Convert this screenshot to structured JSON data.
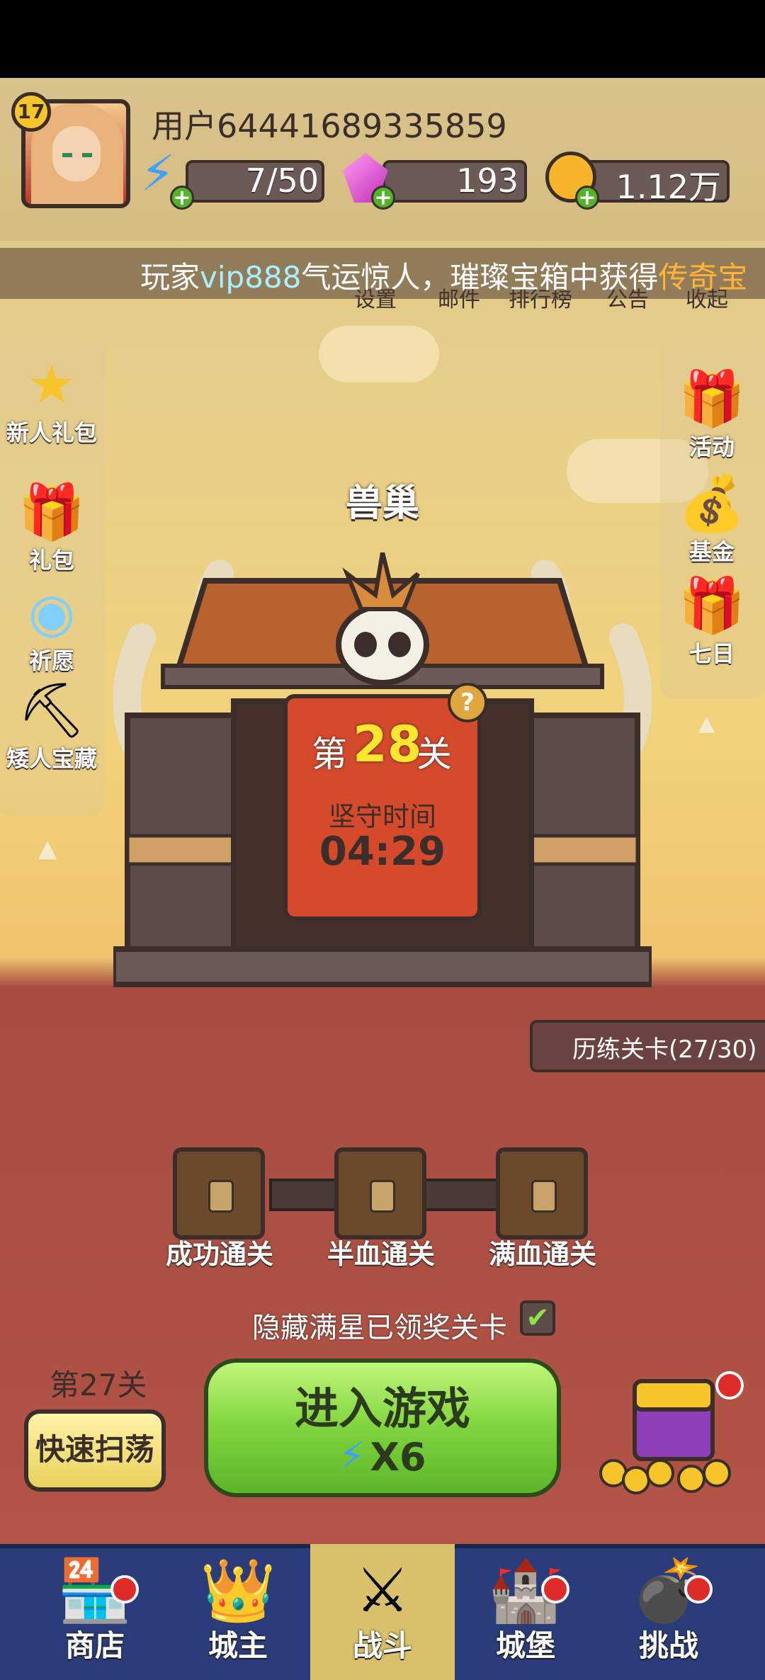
{
  "player": {
    "level": "17",
    "username": "用户64441689335859",
    "energy": "7/50",
    "gems": "193",
    "gold": "1.12万"
  },
  "ticker": {
    "prefix": "玩家",
    "vip": "vip888",
    "middle": "气运惊人，璀璨宝箱中获得",
    "legend": "传奇宝"
  },
  "top_nav": [
    "设置",
    "邮件",
    "排行榜",
    "公告",
    "收起"
  ],
  "left_menu": [
    {
      "label": "新人礼包",
      "icon": "star-1-icon"
    },
    {
      "label": "礼包",
      "icon": "gift-icon"
    },
    {
      "label": "祈愿",
      "icon": "wish-orb-icon"
    },
    {
      "label": "矮人宝藏",
      "icon": "pickaxe-icon"
    }
  ],
  "right_menu": [
    {
      "label": "活动",
      "icon": "activity-gift-icon"
    },
    {
      "label": "基金",
      "icon": "fund-bag-icon"
    },
    {
      "label": "七日",
      "icon": "seven-day-gift-icon"
    }
  ],
  "level": {
    "name": "兽巢",
    "stage_prefix": "第",
    "stage_number": "28",
    "stage_suffix": "关",
    "hold_label": "坚守时间",
    "hold_time": "04:29",
    "help": "?"
  },
  "trial": "历练关卡(27/30)",
  "chests": [
    "成功通关",
    "半血通关",
    "满血通关"
  ],
  "hidden_claim_label": "隐藏满星已领奖关卡",
  "hidden_claim_checked": true,
  "sweep": {
    "stage": "第27关",
    "button": "快速扫荡"
  },
  "enter": {
    "label": "进入游戏",
    "cost": "X6"
  },
  "bottom_nav": [
    {
      "label": "商店",
      "icon": "shop-icon",
      "badge": true,
      "active": false
    },
    {
      "label": "城主",
      "icon": "crown-icon",
      "badge": false,
      "active": false
    },
    {
      "label": "战斗",
      "icon": "crossed-swords-icon",
      "badge": false,
      "active": true
    },
    {
      "label": "城堡",
      "icon": "castle-icon",
      "badge": true,
      "active": false
    },
    {
      "label": "挑战",
      "icon": "challenge-bomb-icon",
      "badge": true,
      "active": false
    }
  ],
  "colors": {
    "nav_bg": "#2a3d7a",
    "nav_active": "#d9c06a",
    "enter_green": "#7fd43c",
    "sign_red": "#d64a2c",
    "stage_yellow": "#ffe62e",
    "ticker_vip": "#a7f0ff",
    "ticker_legend": "#ffb437"
  }
}
